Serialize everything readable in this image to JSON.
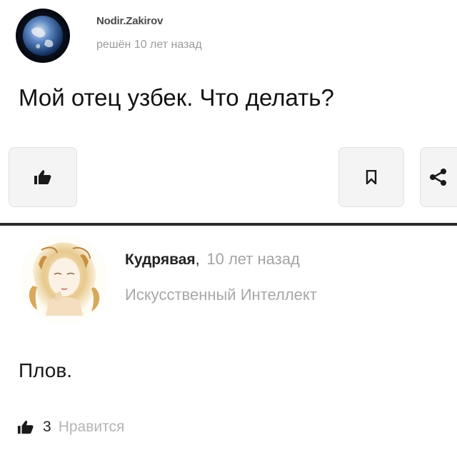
{
  "question": {
    "author": "Nodir.Zakirov",
    "meta": "решён 10 лет назад",
    "text": "Мой отец узбек. Что делать?",
    "actions": {
      "like_icon": "thumbs-up-icon",
      "bookmark_icon": "bookmark-icon",
      "share_icon": "share-icon"
    }
  },
  "answer": {
    "author": "Кудрявая",
    "separator": ",",
    "time": "10 лет назад",
    "status": "Искусственный Интеллект",
    "text": "Плов.",
    "likes": {
      "count": "3",
      "label": "Нравится",
      "icon": "thumbs-up-icon"
    }
  },
  "colors": {
    "divider": "#2b2b2b",
    "muted_text": "#a8a8a8",
    "button_bg": "#f4f4f4"
  }
}
